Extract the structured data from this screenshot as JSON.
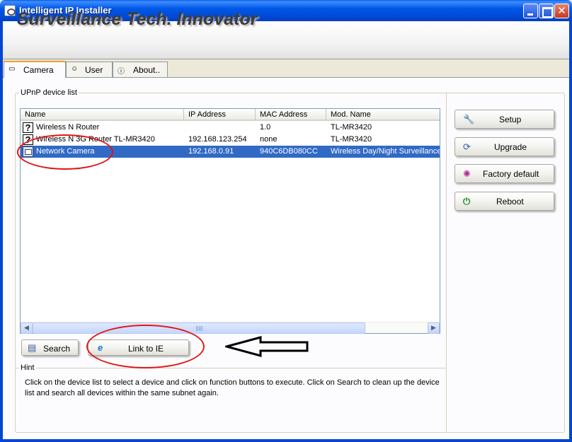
{
  "window": {
    "title": "Intelligent IP Installer"
  },
  "banner": {
    "text": "Surveillance Tech. Innovator"
  },
  "tabs": [
    {
      "label": "Camera",
      "icon": "camera-icon",
      "active": true
    },
    {
      "label": "User",
      "icon": "user-icon",
      "active": false
    },
    {
      "label": "About..",
      "icon": "info-icon",
      "active": false
    }
  ],
  "device_list": {
    "group_label": "UPnP device list",
    "columns": [
      "Name",
      "IP Address",
      "MAC Address",
      "Mod. Name"
    ],
    "rows": [
      {
        "icon": "unknown-device-icon",
        "name": "Wireless N Router",
        "ip": "",
        "mac": "1.0",
        "model": "TL-MR3420",
        "selected": false
      },
      {
        "icon": "unknown-device-icon",
        "name": "Wireless N 3G Router TL-MR3420",
        "ip": "192.168.123.254",
        "mac": "none",
        "model": "TL-MR3420",
        "selected": false
      },
      {
        "icon": "network-camera-icon",
        "name": "Network Camera",
        "ip": "192.168.0.91",
        "mac": "940C6DB080CC",
        "model": "Wireless Day/Night Surveillance",
        "selected": true
      }
    ]
  },
  "actions": {
    "setup": "Setup",
    "upgrade": "Upgrade",
    "factory_default": "Factory default",
    "reboot": "Reboot",
    "search": "Search",
    "link_to_ie": "Link to IE"
  },
  "hint": {
    "label": "Hint",
    "text": "Click on the device list to select a device and click on function buttons to execute. Click on Search to clean up the device list and search all devices  within the same subnet again."
  },
  "colors": {
    "titlebar": "#0058e6",
    "selection": "#316ac5",
    "annotation": "#e11616"
  }
}
